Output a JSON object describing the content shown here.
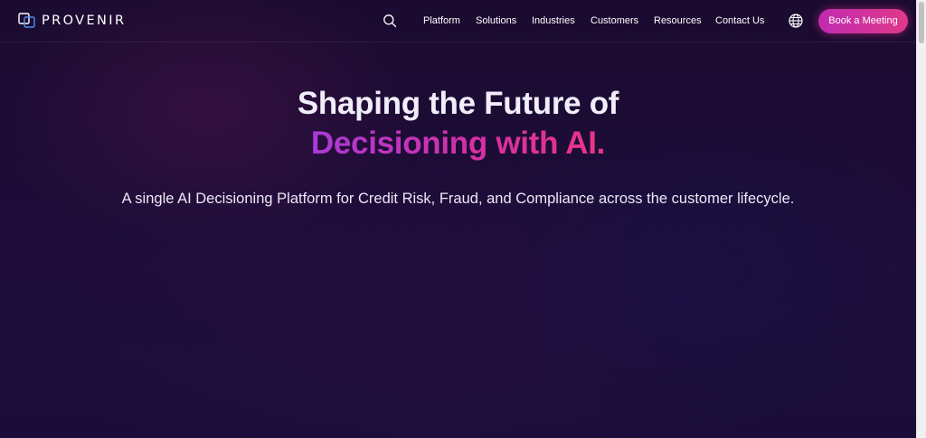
{
  "header": {
    "logo_text": "PROVENIR",
    "nav": [
      "Platform",
      "Solutions",
      "Industries",
      "Customers",
      "Resources",
      "Contact Us"
    ],
    "cta_label": "Book a Meeting",
    "icons": {
      "search": "search-icon",
      "globe": "globe-icon",
      "logo": "logo-icon"
    }
  },
  "hero": {
    "title_line1": "Shaping the Future of",
    "title_line2": "Decisioning with AI.",
    "subtitle": "A single AI Decisioning Platform for Credit Risk, Fraud, and Compliance across the customer lifecycle."
  },
  "colors": {
    "background": "#1c0c35",
    "cta_start": "#c02bb0",
    "cta_end": "#e0398a",
    "gradient_text_start": "#a83bd8",
    "gradient_text_end": "#ea3583"
  }
}
